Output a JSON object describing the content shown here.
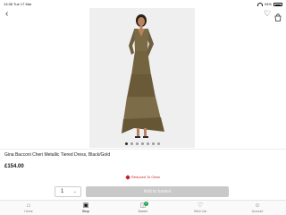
{
  "status_bar": {
    "time": "13:38",
    "date": "Tue 17 Mar",
    "battery": "94%"
  },
  "header": {
    "back_icon": "chevron-left-icon",
    "wishlist_icon": "heart-icon",
    "bag_icon": "bag-icon"
  },
  "product": {
    "title": "Gina Bacconi Cheri Metallic Tiered Dress, Black/Gold",
    "price": "£154.00",
    "reduced_label": "Reduced To Clear",
    "gallery_count": 7,
    "gallery_active": 0
  },
  "basket": {
    "quantity": "1",
    "button_label": "Add to basket"
  },
  "tabbar": [
    {
      "label": "Home",
      "icon": "home-icon"
    },
    {
      "label": "Shop",
      "icon": "shop-icon"
    },
    {
      "label": "Basket",
      "icon": "basket-icon",
      "badge": "1"
    },
    {
      "label": "Wish List",
      "icon": "heart-icon"
    },
    {
      "label": "Account",
      "icon": "account-icon"
    }
  ],
  "colors": {
    "reduced": "#c81d25",
    "badge": "#1aa34a",
    "button_disabled": "#c9c9c9"
  }
}
